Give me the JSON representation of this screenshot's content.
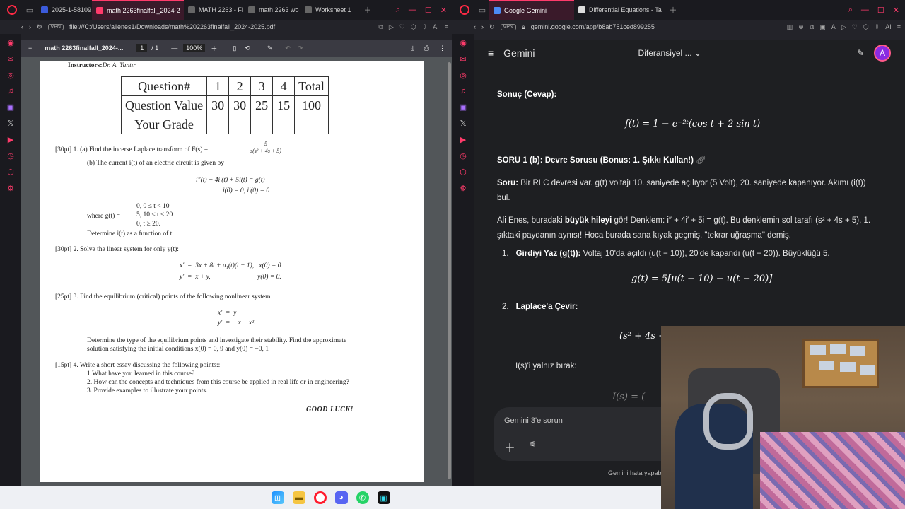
{
  "left_window": {
    "tabs": [
      {
        "label": "2025-1-58109",
        "color": "#3b5bdb",
        "active": false
      },
      {
        "label": "math 2263finalfall_2024-2",
        "color": "#ff3b6b",
        "active": true
      },
      {
        "label": "MATH 2263 - Fi",
        "color": "#888",
        "active": false
      },
      {
        "label": "math 2263 wo",
        "color": "#888",
        "active": false
      },
      {
        "label": "Worksheet 1",
        "color": "#888",
        "active": false
      }
    ],
    "address": "file:///C:/Users/alienes1/Downloads/math%202263finalfall_2024-2025.pdf",
    "vpn": "VPN"
  },
  "pdf": {
    "title": "math 2263finalfall_2024-...",
    "page_current": "1",
    "page_total": "/  1",
    "zoom": "100%",
    "instructors_label": "Instructors:",
    "instructors_name": "Dr. A. Yantır",
    "table": {
      "row1": [
        "Question#",
        "1",
        "2",
        "3",
        "4",
        "Total"
      ],
      "row2": [
        "Question Value",
        "30",
        "30",
        "25",
        "15",
        "100"
      ],
      "row3": [
        "Your Grade",
        "",
        "",
        "",
        "",
        ""
      ]
    },
    "q1_points": "[30pt]",
    "q1a": "1.   (a) Find the incerse Laplace transform of F(s) =",
    "q1a_frac_num": "5",
    "q1a_frac_den": "s(s² + 4s + 5)",
    "q1b": "(b) The current i(t) of an electric circuit is given by",
    "q1_ode": "i″(t) + 4i′(t) + 5i(t) = g(t)",
    "q1_ic": "i(0) = 0,  i′(0) = 0",
    "q1_where": "where g(t) =",
    "q1_g_cases": [
      "0,   0 ≤ t < 10",
      "5,   10 ≤ t < 20",
      "0,   t ≥ 20."
    ],
    "q1_determine": "Determine i(t) as a function of t.",
    "q2_points": "[30pt]",
    "q2": "2.  Solve the linear system for only y(t):",
    "q2_eq1": "x′  =  3x + 8t + u₁(t)(t − 1),   x(0) = 0",
    "q2_eq2": "y′  =  x + y,                            y(0) = 0.",
    "q3_points": "[25pt]",
    "q3": "3.  Find the equilibrium (critical) points of the following nonlinear system",
    "q3_eq1": "x′  =  y",
    "q3_eq2": "y′  =  −x + x².",
    "q3_text1": "Determine the type of the equilibrium points and investigate their stability. Find the approximate",
    "q3_text2": "solution satisfying the initial conditions x(0) = 0, 9 and y(0) = −0, 1",
    "q4_points": "[15pt]",
    "q4": "4.  Write a short essay discussing the following points::",
    "q4_items": [
      "1.What have you learned in this course?",
      "2. How can the concepts and techniques from this course be applied in real life or in engineering?",
      "3. Provide examples to illustrate your points."
    ],
    "good_luck": "GOOD LUCK!"
  },
  "right_window": {
    "tabs": [
      {
        "label": "Google Gemini",
        "color": "#4c8bf5",
        "active": true
      },
      {
        "label": "Differential Equations - Ta",
        "color": "#888",
        "active": false
      }
    ],
    "address": "gemini.google.com/app/b8ab751ced899255",
    "vpn": "VPN"
  },
  "gemini": {
    "brand": "Gemini",
    "chat_title": "Diferansiyel ...",
    "avatar_letter": "A",
    "result_heading": "Sonuç (Cevap):",
    "result_formula": "f(t) = 1 − e⁻²ᵗ(cos t + 2 sin t)",
    "section_heading": "SORU 1 (b): Devre Sorusu (Bonus: 1. Şıkkı Kullan!)",
    "soru_label": "Soru:",
    "soru_text": "Bir RLC devresi var. g(t) voltajı 10. saniyede açılıyor (5 Volt), 20. saniyede kapanıyor. Akımı (i(t)) bul.",
    "para2_a": "Ali Enes, buradaki ",
    "para2_b": "büyük hileyi",
    "para2_c": " gör! Denklem: i″ + 4i′ + 5i = g(t). Bu denklemin sol tarafı (s² + 4s + 5), 1. şıktaki paydanın aynısı! Hoca burada sana kıyak geçmiş, \"tekrar uğraşma\" demiş.",
    "step1_num": "1.",
    "step1_bold": "Girdiyi Yaz (g(t)):",
    "step1_text": " Voltaj 10'da açıldı (u(t − 10)), 20'de kapandı (u(t − 20)). Büyüklüğü 5.",
    "step1_formula": "g(t) = 5[u(t − 10) − u(t − 20)]",
    "step2_num": "2.",
    "step2_bold": "Laplace'a Çevir:",
    "step2_formula_partial": "(s² + 4s +",
    "isolate_text": "I(s)'i yalnız bırak:",
    "isolate_formula_partial": "I(s) = (",
    "prompt_placeholder": "Gemini 3'e sorun",
    "disclaimer": "Gemini hata yapab"
  },
  "taskbar": {
    "icons": [
      "windows-start",
      "file-explorer",
      "opera",
      "discord",
      "whatsapp",
      "twitch-app"
    ]
  }
}
